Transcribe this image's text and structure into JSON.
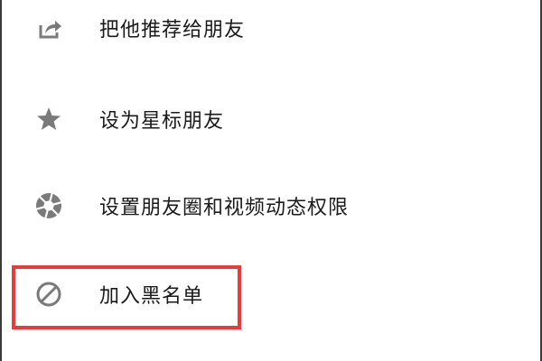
{
  "menu": {
    "items": [
      {
        "label": "把他推荐给朋友",
        "icon": "share-icon"
      },
      {
        "label": "设为星标朋友",
        "icon": "star-icon"
      },
      {
        "label": "设置朋友圈和视频动态权限",
        "icon": "aperture-icon"
      },
      {
        "label": "加入黑名单",
        "icon": "block-icon"
      }
    ]
  },
  "colors": {
    "icon": "#7a7a7a",
    "text": "#1a1a1a",
    "highlight": "#e83b3b"
  }
}
